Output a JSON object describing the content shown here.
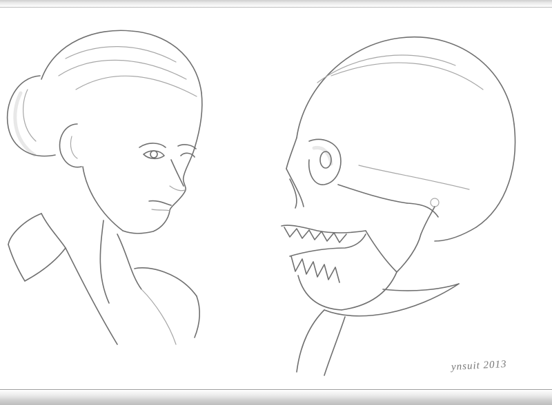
{
  "artwork": {
    "signature": "ynsuit 2013",
    "subjects": [
      "woman-portrait",
      "skull-profile"
    ],
    "palette": {
      "paper": "#ffffff",
      "pencil": "#6f6f6f",
      "edge": "#bdbdbd"
    }
  }
}
